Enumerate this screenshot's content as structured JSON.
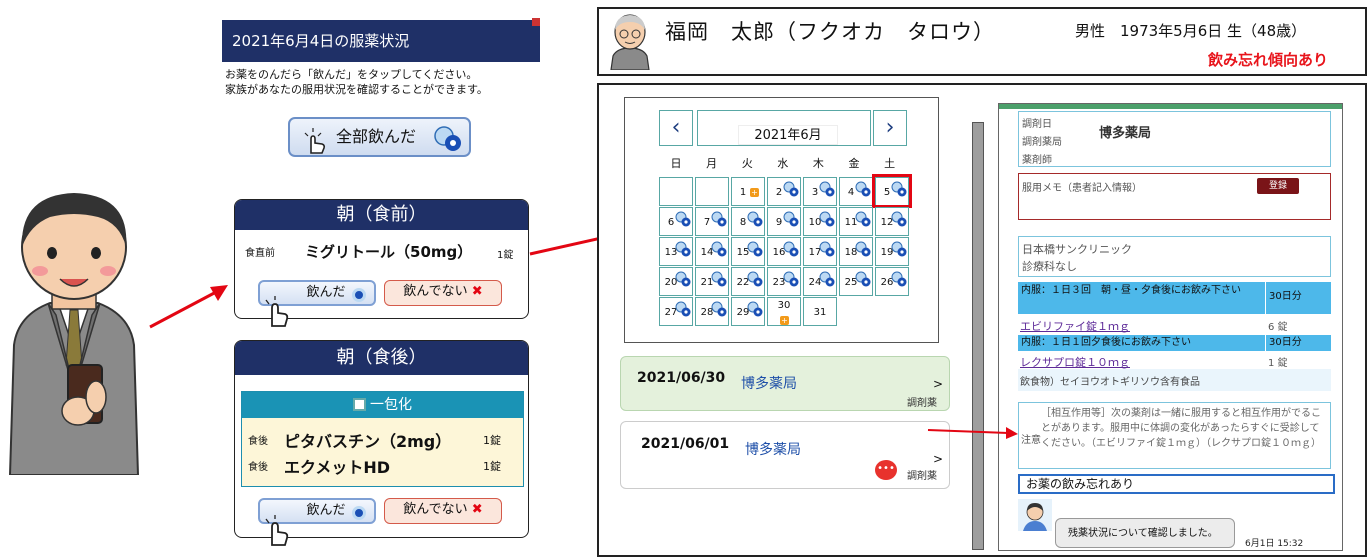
{
  "phone": {
    "title": "2021年6月4日の服薬状況",
    "instruction_1": "お薬をのんだら「飲んだ」をタップしてください。",
    "instruction_2": "家族があなたの服用状況を確認することができます。",
    "all_taken_label": "全部飲んだ",
    "morning_before": {
      "header": "朝（食前）",
      "timing": "食直前",
      "drug": "ミグリトール（50mg）",
      "dose": "1錠",
      "taken_label": "飲んだ",
      "not_taken_label": "飲んでない"
    },
    "morning_after": {
      "header": "朝（食後）",
      "pack_label": "一包化",
      "items": [
        {
          "timing": "食後",
          "drug": "ピタバスチン（2mg）",
          "dose": "1錠"
        },
        {
          "timing": "食後",
          "drug": "エクメットHD",
          "dose": "1錠"
        }
      ],
      "taken_label": "飲んだ",
      "not_taken_label": "飲んでない"
    }
  },
  "patient": {
    "name": "福岡　太郎（フクオカ　タロウ）",
    "info": "男性　1973年5月6日 生（48歳）",
    "warning": "飲み忘れ傾向あり"
  },
  "calendar": {
    "month": "2021年6月",
    "prev": "‹",
    "next": "›",
    "weekdays": [
      "日",
      "月",
      "火",
      "水",
      "木",
      "金",
      "土"
    ],
    "highlight_day": "5"
  },
  "history": [
    {
      "date": "2021/06/30",
      "pharmacy": "博多薬局",
      "type": "調剤薬",
      "arrow": ">"
    },
    {
      "date": "2021/06/01",
      "pharmacy": "博多薬局",
      "type": "調剤薬",
      "arrow": ">"
    }
  ],
  "detail": {
    "label_date": "調剤日",
    "label_pharmacy": "調剤薬局",
    "label_pharmacist": "薬剤師",
    "pharmacy": "博多薬局",
    "memo_label": "服用メモ（患者記入情報）",
    "register": "登録",
    "clinic": "日本橋サンクリニック",
    "dept": "診療科なし",
    "rx1_header": "内服：１日３回　朝・昼・夕食後にお飲み下さい",
    "rx1_days": "30日分",
    "rx1_drug": "エビリファイ錠１ｍｇ",
    "rx1_qty": "6 錠",
    "rx2_header": "内服：１日１回夕食後にお飲み下さい",
    "rx2_days": "30日分",
    "rx2_drug": "レクサプロ錠１０ｍｇ",
    "rx2_qty": "1 錠",
    "food": "飲食物）セイヨウオトギリソウ含有食品",
    "note_label": "注意",
    "note_text": "［相互作用等］次の薬剤は一緒に服用すると相互作用がでることがあります。服用中に体調の変化があったらすぐに受診してください。（エビリファイ錠１ｍｇ）（レクサプロ錠１０ｍｇ）",
    "forgot": "お薬の飲み忘れあり",
    "chat": "残薬状況について確認しました。",
    "chat_time": "6月1日 15:32"
  },
  "colors": {
    "navy": "#1f3067",
    "red": "#e30613",
    "teal": "#1a93b5",
    "blue": "#4db8ea"
  }
}
